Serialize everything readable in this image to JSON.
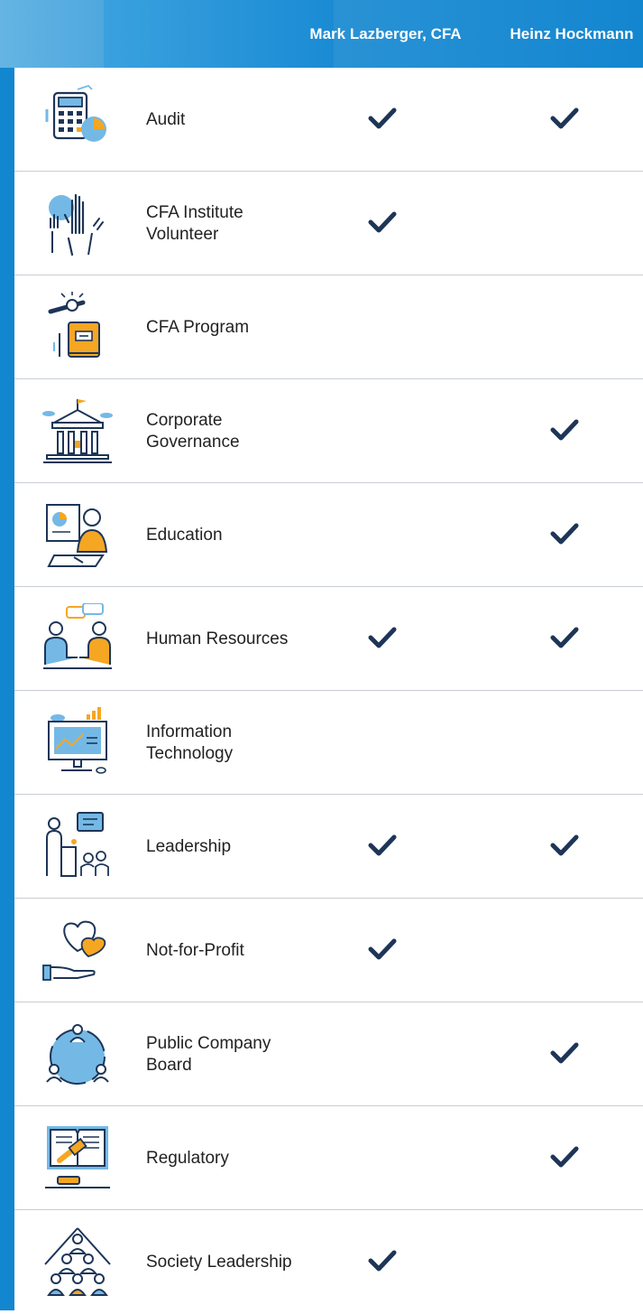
{
  "header": {
    "col1_label": "Mark Lazberger, CFA",
    "col2_label": "Heinz Hockmann"
  },
  "colors": {
    "header_blue": "#1386d0",
    "check_navy": "#1d3557",
    "icon_orange": "#f5a623",
    "icon_lightblue": "#74b9e6"
  },
  "rows": [
    {
      "label": "Audit",
      "icon": "calculator-chart-icon",
      "col1": true,
      "col2": true
    },
    {
      "label": "CFA Institute Volunteer",
      "icon": "raised-hands-icon",
      "col1": true,
      "col2": false
    },
    {
      "label": "CFA Program",
      "icon": "pen-book-icon",
      "col1": false,
      "col2": false
    },
    {
      "label": "Corporate Governance",
      "icon": "building-columns-icon",
      "col1": false,
      "col2": true
    },
    {
      "label": "Education",
      "icon": "teacher-presentation-icon",
      "col1": false,
      "col2": true
    },
    {
      "label": "Human Resources",
      "icon": "two-people-talking-icon",
      "col1": true,
      "col2": true
    },
    {
      "label": "Information Technology",
      "icon": "computer-monitor-icon",
      "col1": false,
      "col2": false
    },
    {
      "label": "Leadership",
      "icon": "speaker-podium-icon",
      "col1": true,
      "col2": true
    },
    {
      "label": "Not-for-Profit",
      "icon": "hand-heart-icon",
      "col1": true,
      "col2": false
    },
    {
      "label": "Public Company Board",
      "icon": "people-circle-icon",
      "col1": false,
      "col2": true
    },
    {
      "label": "Regulatory",
      "icon": "gavel-book-icon",
      "col1": false,
      "col2": true
    },
    {
      "label": "Society Leadership",
      "icon": "group-pyramid-icon",
      "col1": true,
      "col2": false
    }
  ]
}
